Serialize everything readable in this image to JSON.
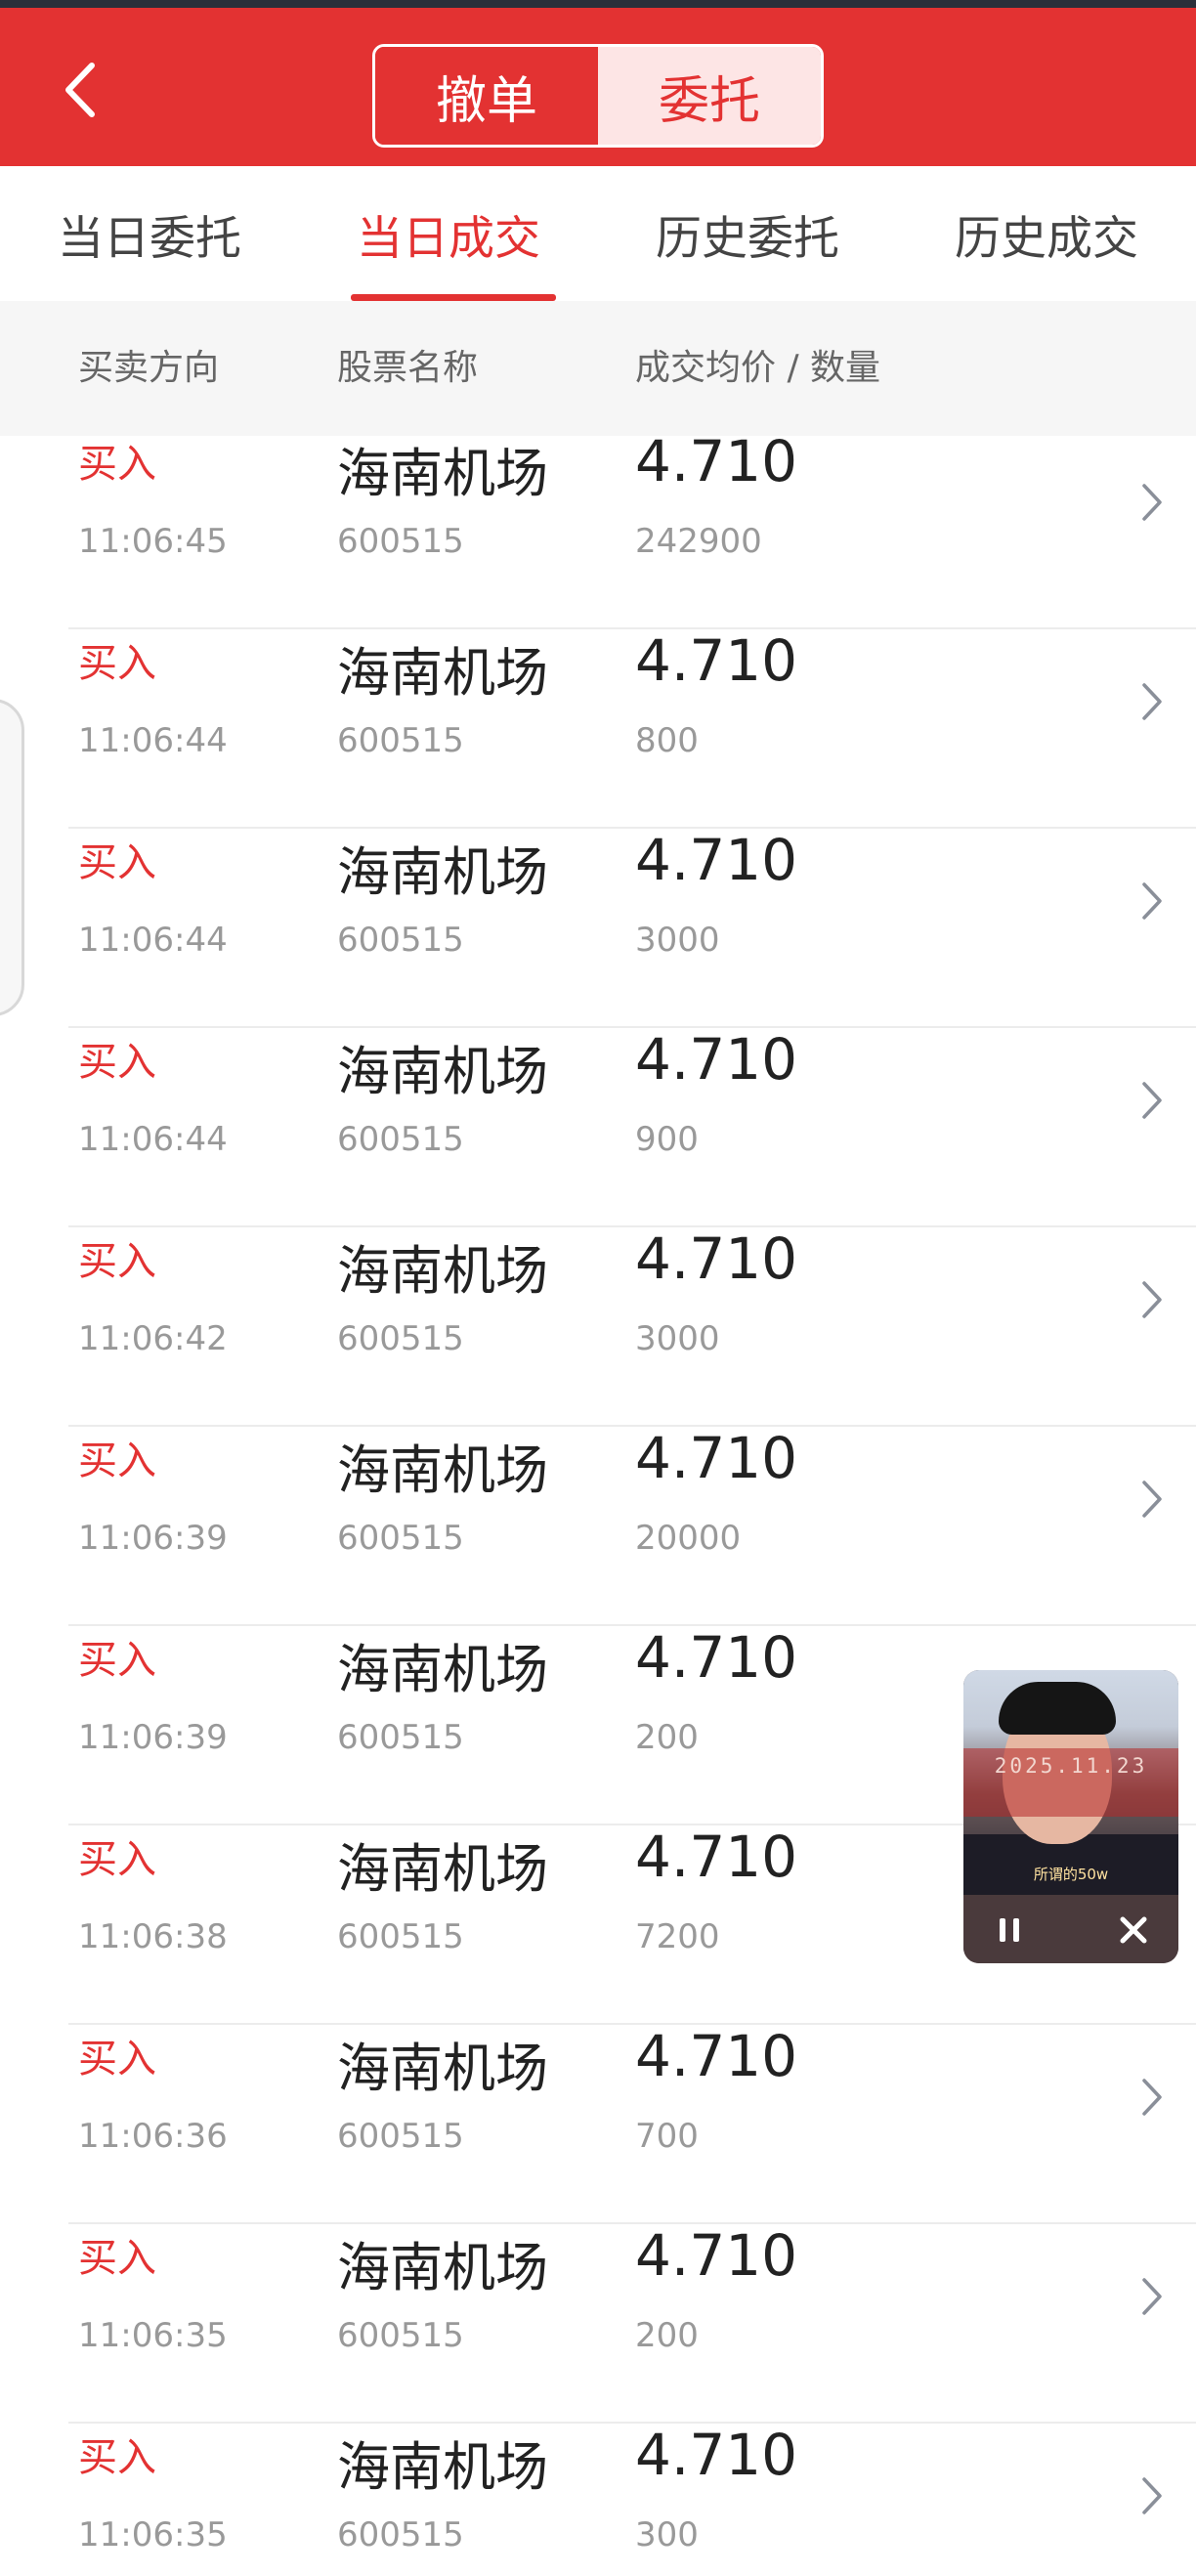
{
  "topbar": {
    "segments": [
      {
        "label": "撤单",
        "active": true
      },
      {
        "label": "委托",
        "active": false
      }
    ]
  },
  "tabs": [
    {
      "label": "当日委托",
      "active": false
    },
    {
      "label": "当日成交",
      "active": true
    },
    {
      "label": "历史委托",
      "active": false
    },
    {
      "label": "历史成交",
      "active": false
    }
  ],
  "columns": {
    "direction": "买卖方向",
    "stock": "股票名称",
    "price_qty": "成交均价 / 数量"
  },
  "trades": [
    {
      "direction": "买入",
      "time": "11:06:45",
      "name": "海南机场",
      "code": "600515",
      "price": "4.710",
      "qty": "242900"
    },
    {
      "direction": "买入",
      "time": "11:06:44",
      "name": "海南机场",
      "code": "600515",
      "price": "4.710",
      "qty": "800"
    },
    {
      "direction": "买入",
      "time": "11:06:44",
      "name": "海南机场",
      "code": "600515",
      "price": "4.710",
      "qty": "3000"
    },
    {
      "direction": "买入",
      "time": "11:06:44",
      "name": "海南机场",
      "code": "600515",
      "price": "4.710",
      "qty": "900"
    },
    {
      "direction": "买入",
      "time": "11:06:42",
      "name": "海南机场",
      "code": "600515",
      "price": "4.710",
      "qty": "3000"
    },
    {
      "direction": "买入",
      "time": "11:06:39",
      "name": "海南机场",
      "code": "600515",
      "price": "4.710",
      "qty": "20000"
    },
    {
      "direction": "买入",
      "time": "11:06:39",
      "name": "海南机场",
      "code": "600515",
      "price": "4.710",
      "qty": "200"
    },
    {
      "direction": "买入",
      "time": "11:06:38",
      "name": "海南机场",
      "code": "600515",
      "price": "4.710",
      "qty": "7200"
    },
    {
      "direction": "买入",
      "time": "11:06:36",
      "name": "海南机场",
      "code": "600515",
      "price": "4.710",
      "qty": "700"
    },
    {
      "direction": "买入",
      "time": "11:06:35",
      "name": "海南机场",
      "code": "600515",
      "price": "4.710",
      "qty": "200"
    },
    {
      "direction": "买入",
      "time": "11:06:35",
      "name": "海南机场",
      "code": "600515",
      "price": "4.710",
      "qty": "300"
    }
  ],
  "pip": {
    "date_overlay": "2025.11.23",
    "caption": "所谓的50w"
  },
  "colors": {
    "brand_red": "#e33232",
    "muted_text": "#999999",
    "primary_text": "#222222"
  },
  "icons": {
    "back": "chevron-left-icon",
    "row": "chevron-right-icon",
    "pip_pause": "pause-icon",
    "pip_close": "close-icon"
  }
}
